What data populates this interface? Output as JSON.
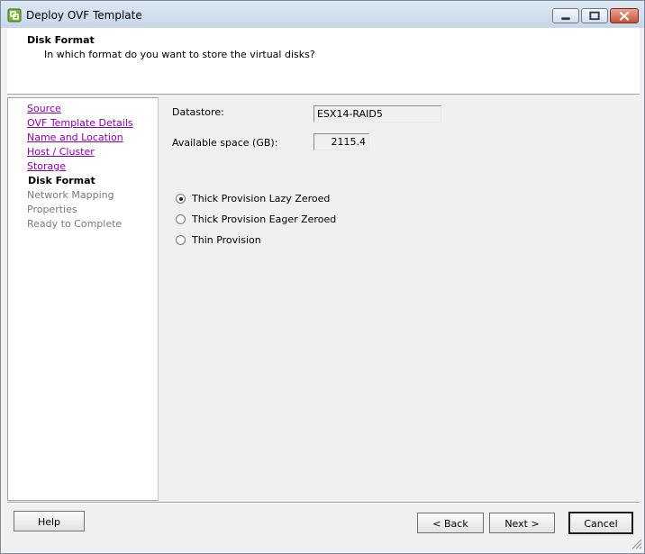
{
  "window": {
    "title": "Deploy OVF Template",
    "icons": {
      "app": "ovf-deploy-icon",
      "minimize": "minimize-icon",
      "maximize": "maximize-icon",
      "close": "close-icon"
    }
  },
  "header": {
    "title": "Disk Format",
    "subtitle": "In which format do you want to store the virtual disks?"
  },
  "nav": {
    "items": [
      {
        "label": "Source",
        "state": "link"
      },
      {
        "label": "OVF Template Details",
        "state": "link"
      },
      {
        "label": "Name and Location",
        "state": "link"
      },
      {
        "label": "Host / Cluster",
        "state": "link"
      },
      {
        "label": "Storage",
        "state": "link"
      },
      {
        "label": "Disk Format",
        "state": "current"
      },
      {
        "label": "Network Mapping",
        "state": "disabled"
      },
      {
        "label": "Properties",
        "state": "disabled"
      },
      {
        "label": "Ready to Complete",
        "state": "disabled"
      }
    ],
    "colors": {
      "link": "#8a00a8",
      "disabled": "#7a7a7a"
    }
  },
  "form": {
    "datastore_label": "Datastore:",
    "datastore_value": "ESX14-RAID5",
    "space_label": "Available space (GB):",
    "space_value": "2115.4",
    "options": [
      {
        "label": "Thick Provision Lazy Zeroed",
        "selected": true
      },
      {
        "label": "Thick Provision Eager Zeroed",
        "selected": false
      },
      {
        "label": "Thin Provision",
        "selected": false
      }
    ]
  },
  "buttons": {
    "help": "Help",
    "back": "< Back",
    "next": "Next >",
    "cancel": "Cancel"
  }
}
